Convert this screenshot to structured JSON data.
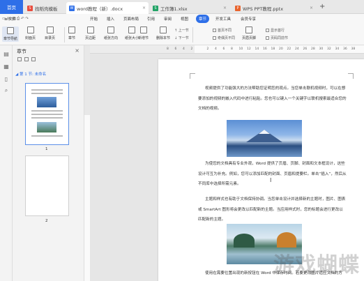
{
  "tabs": {
    "home": "首页",
    "t1": "找稻壳模板",
    "t2": "word教程（新）.docx",
    "t3": "工作簿1.xlsx",
    "t4": "WPS PPT教程.pptx",
    "plus": "+"
  },
  "menu": [
    "≡ 文件",
    "开始",
    "插入",
    "页面布局",
    "引用",
    "审阅",
    "视图",
    "章节",
    "开发工具",
    "会员专享"
  ],
  "ribbon": {
    "buttons": [
      "章节导航",
      "封面页",
      "目录页",
      "章节",
      "页边距",
      "纸张方向",
      "纸张大小",
      "新增节",
      "删除本节",
      "上一节",
      "下一节",
      "页眉页脚"
    ],
    "checks": [
      "首页不同",
      "奇偶页不同",
      "页眉页脚同前节",
      "显示首行",
      "页码同前节"
    ]
  },
  "nav": {
    "title": "章节",
    "close": "×",
    "section": "第 1 节: 未命名",
    "page1": "1",
    "page2": "2"
  },
  "doc": {
    "p1": "视频提供了功能强大的方法帮助您证明您的观点。当您单击联机视频时，可以在想要添加的视频的嵌入代码中进行粘贴。您也可以键入一个关键字以联机搜索最适合您的文档的视频。",
    "p2": "为使您的文档具有专业外观，Word 提供了页眉、页脚、封面和文本框设计，这些设计可互为补充。例如，您可以添加匹配的封面、页眉和提要栏。单击“插入”，然后从不同库中选择所需元素。",
    "p3": "主题和样式也有助于文档保持协调。当您单击设计并选择新的主题时，图片、图表或 SmartArt 图形将会更改以匹配新的主题。当应用样式时，您的标题会进行更改以匹配新的主题。",
    "p4": "使用在需要位置出现的新按钮在 Word 中保存时间。若要更改图片适应文档的方式，"
  },
  "ruler_marks": [
    "8",
    "6",
    "4",
    "2",
    "",
    "2",
    "4",
    "6",
    "8",
    "10",
    "12",
    "14",
    "16",
    "18",
    "20",
    "22",
    "24",
    "26",
    "28",
    "30",
    "32",
    "34",
    "36",
    "38"
  ],
  "watermark": "游戏蝴蝶",
  "colors": {
    "accent": "#2e6fe8",
    "selected_tab": "#2e6fe8"
  }
}
